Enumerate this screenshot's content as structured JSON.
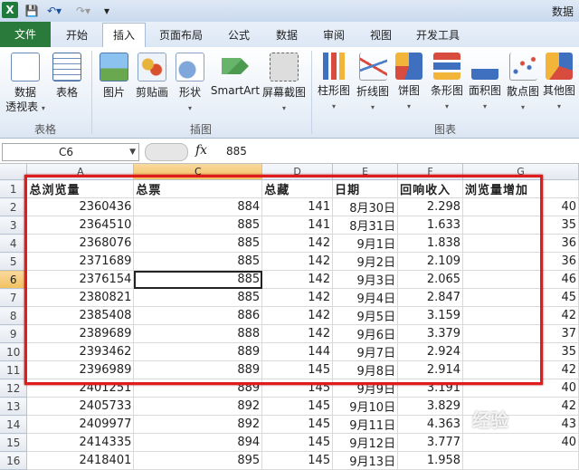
{
  "title_bar": {
    "title": "数据"
  },
  "tabs": [
    "文件",
    "开始",
    "插入",
    "页面布局",
    "公式",
    "数据",
    "审阅",
    "视图",
    "开发工具"
  ],
  "active_tab": "插入",
  "ribbon": {
    "groups": [
      {
        "label": "表格",
        "buttons": [
          {
            "label": "数据\n透视表",
            "dropdown": true,
            "icon": "pivot-table-icon"
          },
          {
            "label": "表格",
            "icon": "table-icon"
          }
        ]
      },
      {
        "label": "插图",
        "buttons": [
          {
            "label": "图片",
            "icon": "picture-icon"
          },
          {
            "label": "剪贴画",
            "icon": "clipart-icon"
          },
          {
            "label": "形状",
            "dropdown": true,
            "icon": "shapes-icon"
          },
          {
            "label": "SmartArt",
            "icon": "smartart-icon"
          },
          {
            "label": "屏幕截图",
            "dropdown": true,
            "icon": "screenshot-icon"
          }
        ]
      },
      {
        "label": "图表",
        "buttons": [
          {
            "label": "柱形图",
            "dropdown": true,
            "icon": "column-chart-icon"
          },
          {
            "label": "折线图",
            "dropdown": true,
            "icon": "line-chart-icon"
          },
          {
            "label": "饼图",
            "dropdown": true,
            "icon": "pie-chart-icon"
          },
          {
            "label": "条形图",
            "dropdown": true,
            "icon": "bar-chart-icon"
          },
          {
            "label": "面积图",
            "dropdown": true,
            "icon": "area-chart-icon"
          },
          {
            "label": "散点图",
            "dropdown": true,
            "icon": "scatter-chart-icon"
          },
          {
            "label": "其他图",
            "dropdown": true,
            "icon": "other-chart-icon"
          }
        ]
      }
    ]
  },
  "formula_bar": {
    "name_box": "C6",
    "fx": "fx",
    "value": "885"
  },
  "sheet": {
    "columns": [
      "A",
      "C",
      "D",
      "E",
      "F",
      "G"
    ],
    "selected_column": "C",
    "selected_row": "6",
    "row_numbers": [
      "1",
      "2",
      "3",
      "4",
      "5",
      "6",
      "7",
      "8",
      "9",
      "10",
      "11",
      "12",
      "13",
      "14",
      "15",
      "16"
    ],
    "header": [
      "总浏览量",
      "总票",
      "总藏",
      "日期",
      "回响收入",
      "浏览量增加"
    ],
    "rows": [
      [
        "2360436",
        "884",
        "141",
        "8月30日",
        "2.298",
        "40"
      ],
      [
        "2364510",
        "885",
        "141",
        "8月31日",
        "1.633",
        "35"
      ],
      [
        "2368076",
        "885",
        "142",
        "9月1日",
        "1.838",
        "36"
      ],
      [
        "2371689",
        "885",
        "142",
        "9月2日",
        "2.109",
        "36"
      ],
      [
        "2376154",
        "885",
        "142",
        "9月3日",
        "2.065",
        "46"
      ],
      [
        "2380821",
        "885",
        "142",
        "9月4日",
        "2.847",
        "45"
      ],
      [
        "2385408",
        "886",
        "142",
        "9月5日",
        "3.159",
        "42"
      ],
      [
        "2389689",
        "888",
        "142",
        "9月6日",
        "3.379",
        "37"
      ],
      [
        "2393462",
        "889",
        "144",
        "9月7日",
        "2.924",
        "35"
      ],
      [
        "2396989",
        "889",
        "145",
        "9月8日",
        "2.914",
        "42"
      ],
      [
        "2401251",
        "889",
        "145",
        "9月9日",
        "3.191",
        "40"
      ],
      [
        "2405733",
        "892",
        "145",
        "9月10日",
        "3.829",
        "42"
      ],
      [
        "2409977",
        "892",
        "145",
        "9月11日",
        "4.363",
        "43"
      ],
      [
        "2414335",
        "894",
        "145",
        "9月12日",
        "3.777",
        "40"
      ],
      [
        "2418401",
        "895",
        "145",
        "9月13日",
        "1.958",
        ""
      ]
    ]
  },
  "watermark": "经验"
}
